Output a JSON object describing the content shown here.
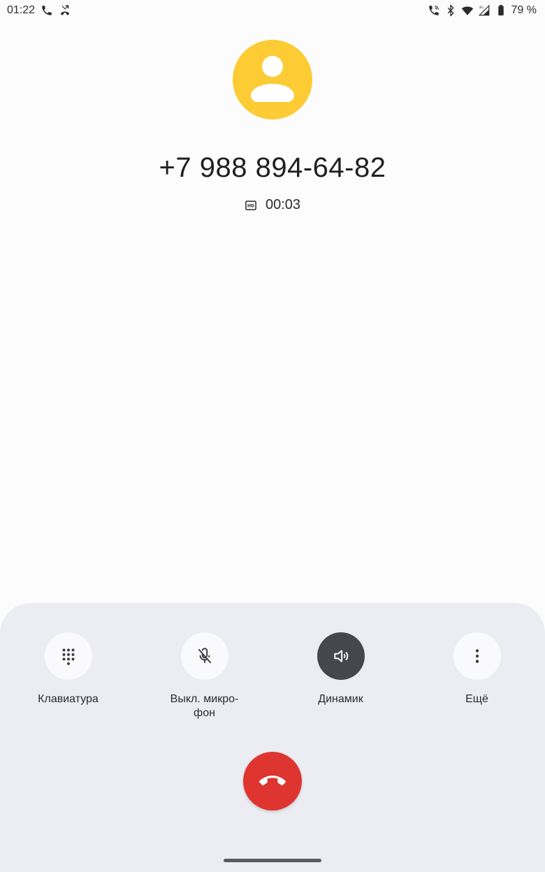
{
  "status_bar": {
    "time": "01:22",
    "battery": "79 %",
    "left_icons": [
      "phone-icon",
      "missed-call-icon"
    ],
    "right_icons": [
      "wifi-calling-icon",
      "bluetooth-icon",
      "wifi-icon",
      "signal-3g-icon",
      "battery-icon"
    ]
  },
  "call": {
    "number": "+7 988 894-64-82",
    "duration": "00:03",
    "hd_icon": "hd-icon",
    "avatar_color": "#fdcb33"
  },
  "controls": [
    {
      "label": "Клавиатура",
      "icon": "dialpad-icon",
      "active": false
    },
    {
      "label": "Выкл. микро-\nфон",
      "icon": "mic-off-icon",
      "active": false
    },
    {
      "label": "Динамик",
      "icon": "speaker-icon",
      "active": true
    },
    {
      "label": "Ещё",
      "icon": "more-vert-icon",
      "active": false
    }
  ],
  "end_call": {
    "icon": "call-end-icon",
    "color": "#df3531"
  }
}
